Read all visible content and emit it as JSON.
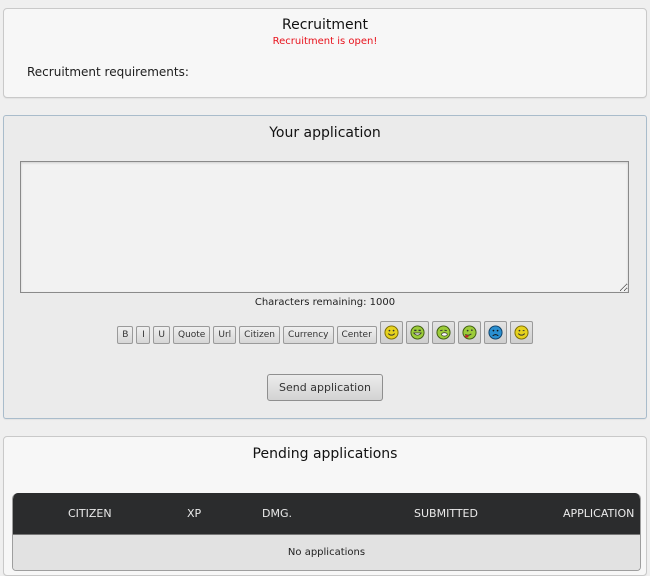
{
  "recruitment": {
    "title": "Recruitment",
    "status": "Recruitment is open!",
    "status_color": "#e8121c",
    "requirements_label": "Recruitment requirements:"
  },
  "application": {
    "title": "Your application",
    "textarea_value": "",
    "chars_remaining_label": "Characters remaining:",
    "chars_remaining_value": "1000",
    "toolbar": {
      "bold": "B",
      "italic": "I",
      "underline": "U",
      "quote": "Quote",
      "url": "Url",
      "citizen": "Citizen",
      "currency": "Currency",
      "center": "Center"
    },
    "smileys": [
      {
        "name": "smile-icon",
        "color": "#e6d21e"
      },
      {
        "name": "grin-icon",
        "color": "#9ccc3a"
      },
      {
        "name": "sick-icon",
        "color": "#9ccc3a"
      },
      {
        "name": "tongue-icon",
        "color": "#9ccc3a"
      },
      {
        "name": "sad-icon",
        "color": "#2a8fd0"
      },
      {
        "name": "wink-icon",
        "color": "#e6d21e"
      }
    ],
    "send_label": "Send application"
  },
  "pending": {
    "title": "Pending applications",
    "columns": [
      "CITIZEN",
      "XP",
      "DMG.",
      "SUBMITTED",
      "APPLICATION"
    ],
    "empty_message": "No applications"
  }
}
